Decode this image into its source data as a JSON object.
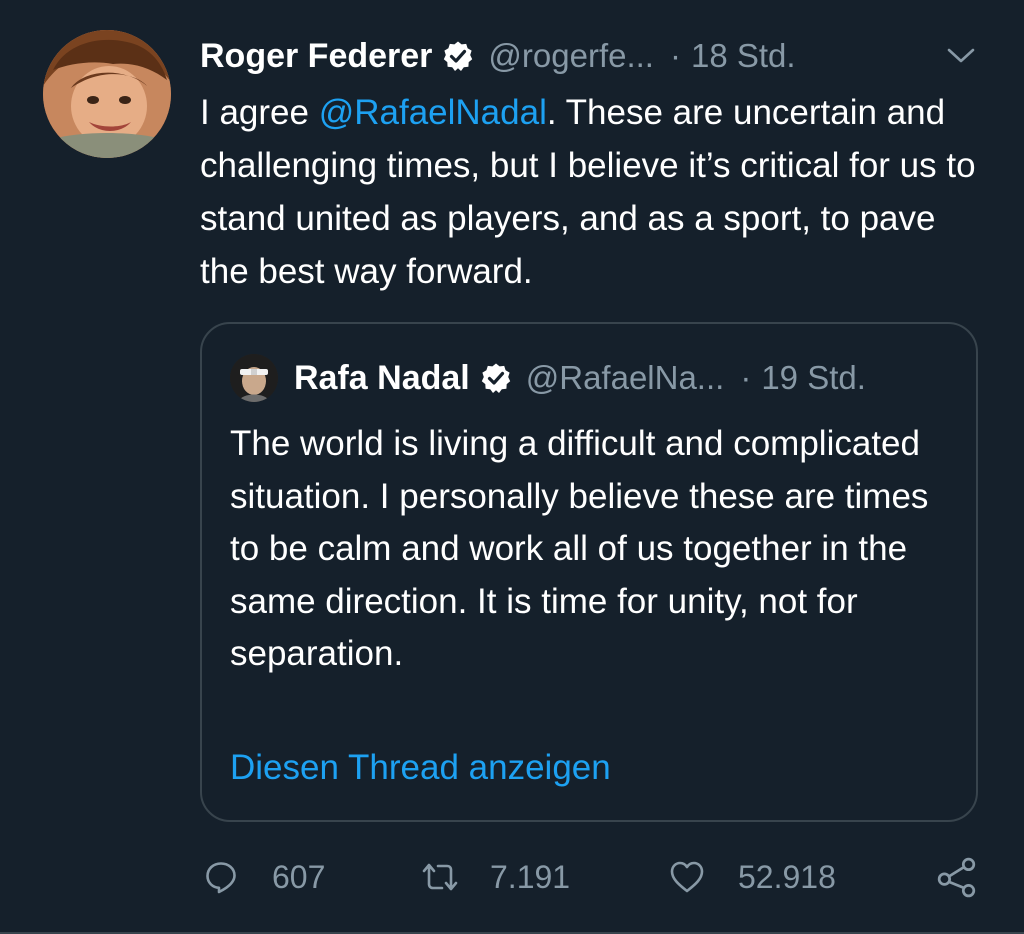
{
  "tweet": {
    "author_name": "Roger Federer",
    "author_handle": "@rogerfe...",
    "separator": "·",
    "time": "18 Std.",
    "text_before_mention": "I agree ",
    "mention": "@RafaelNadal",
    "text_after_mention": ". These are uncertain and challenging times, but I believe it’s critical for us to stand united as players, and as a sport, to pave the best way forward."
  },
  "quoted_tweet": {
    "author_name": "Rafa Nadal",
    "author_handle": "@RafaelNa...",
    "separator": "·",
    "time": "19 Std.",
    "text": "The world is living a difficult and complicated situation. I personally believe these are times to be calm and work all of us together in the same direction. It is time for unity, not for separation.",
    "show_thread_label": "Diesen Thread anzeigen"
  },
  "actions": {
    "replies": "607",
    "retweets": "7.191",
    "likes": "52.918"
  },
  "colors": {
    "background": "#15202b",
    "accent": "#1da1f2",
    "secondary_text": "#8899a6",
    "border": "#38444d"
  },
  "icons": {
    "verified": "verified-badge-icon",
    "caret": "chevron-down-icon",
    "reply": "reply-icon",
    "retweet": "retweet-icon",
    "like": "heart-icon",
    "share": "share-icon"
  }
}
